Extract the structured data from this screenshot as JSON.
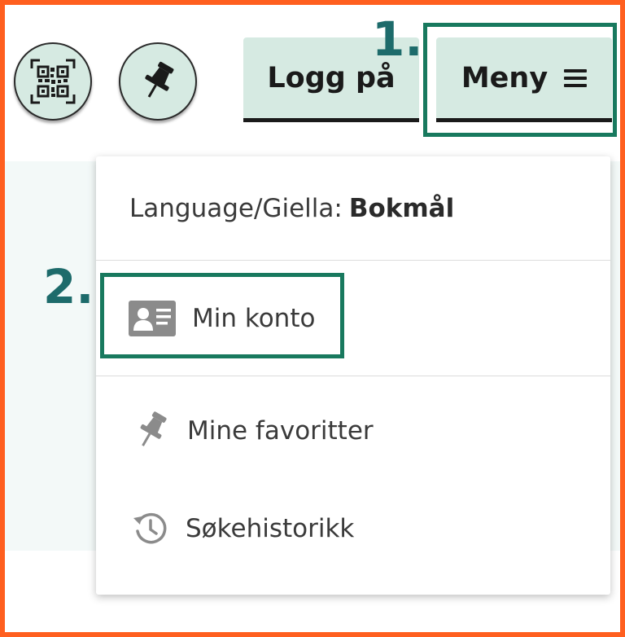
{
  "header": {
    "qr_button_icon": "qr-code-icon",
    "pin_button_icon": "pushpin-icon",
    "login_label": "Logg på",
    "menu_label": "Meny",
    "menu_icon": "hamburger-icon"
  },
  "annotations": {
    "step1": "1.",
    "step2": "2."
  },
  "dropdown": {
    "language_prefix": "Language/Giella:",
    "language_value": "Bokmål",
    "items": [
      {
        "label": "Min konto",
        "icon": "id-card-icon"
      },
      {
        "label": "Mine favoritter",
        "icon": "pushpin-icon"
      },
      {
        "label": "Søkehistorikk",
        "icon": "history-icon"
      }
    ]
  },
  "colors": {
    "button_bg": "#d6eae2",
    "callout": "#18795e",
    "callout_number": "#1d6b6b",
    "frame": "#ff5f1f",
    "panel_bg": "#f3f9f8"
  }
}
